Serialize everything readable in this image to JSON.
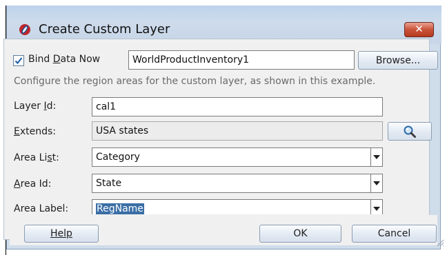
{
  "dialog": {
    "title": "Create Custom Layer",
    "close_label": "✕"
  },
  "bind_data": {
    "checkbox_label_pre": "Bind ",
    "checkbox_label_u": "D",
    "checkbox_label_post": "ata Now",
    "checked": true,
    "value": "WorldProductInventory1",
    "browse_label": "Browse..."
  },
  "instructions": "Configure the region areas for the custom layer, as shown in this example.",
  "form": {
    "layer_id": {
      "label_pre": "Layer ",
      "label_u": "I",
      "label_post": "d:",
      "value": "cal1"
    },
    "extends": {
      "label_u": "E",
      "label_post": "xtends:",
      "value": "USA states"
    },
    "area_list": {
      "label_pre": "Area Li",
      "label_u": "s",
      "label_post": "t:",
      "value": "Category"
    },
    "area_id": {
      "label_u": "A",
      "label_post": "rea Id:",
      "value": "State"
    },
    "area_label": {
      "label": "Area Label:",
      "value": "RegName"
    }
  },
  "buttons": {
    "help": "Help",
    "ok": "OK",
    "cancel": "Cancel"
  },
  "icons": {
    "app": "oracle-jdeveloper-icon",
    "search": "magnifier-icon",
    "close": "close-icon",
    "checkbox": "checkmark-icon",
    "dropdown": "chevron-down-icon"
  }
}
